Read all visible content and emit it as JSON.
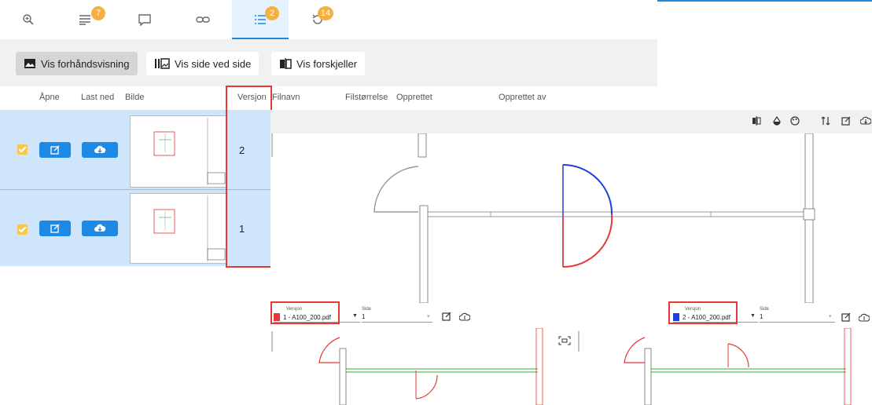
{
  "tabs": [
    {
      "icon": "zoom-icon"
    },
    {
      "icon": "list-icon",
      "badge": "7"
    },
    {
      "icon": "comment-icon"
    },
    {
      "icon": "link-icon"
    },
    {
      "icon": "numbered-list-icon",
      "badge": "2"
    },
    {
      "icon": "history-icon",
      "badge": "14"
    }
  ],
  "toolbar": {
    "preview": "Vis forhåndsvisning",
    "side_by_side": "Vis side ved side",
    "diff": "Vis forskjeller"
  },
  "table": {
    "headers": {
      "open": "Åpne",
      "download": "Last ned",
      "image": "Bilde",
      "version": "Versjon",
      "filename": "Filnavn",
      "filesize": "Filstørrelse",
      "created": "Opprettet",
      "created_by": "Opprettet av"
    },
    "rows": [
      {
        "version": "2",
        "checked": true
      },
      {
        "version": "1",
        "checked": true
      }
    ]
  },
  "viewer": {
    "left": {
      "version_label": "Versjon",
      "version": "1 - A100_200.pdf",
      "side_label": "Side",
      "side": "1",
      "color": "#e53935"
    },
    "right": {
      "version_label": "Versjon",
      "version": "2 - A100_200.pdf",
      "side_label": "Side",
      "side": "1",
      "color": "#1e3fd6"
    }
  },
  "colors": {
    "accent": "#1e88e5",
    "badge": "#f5b041",
    "selected_row": "#cfe5fb",
    "highlight": "#e53935"
  }
}
